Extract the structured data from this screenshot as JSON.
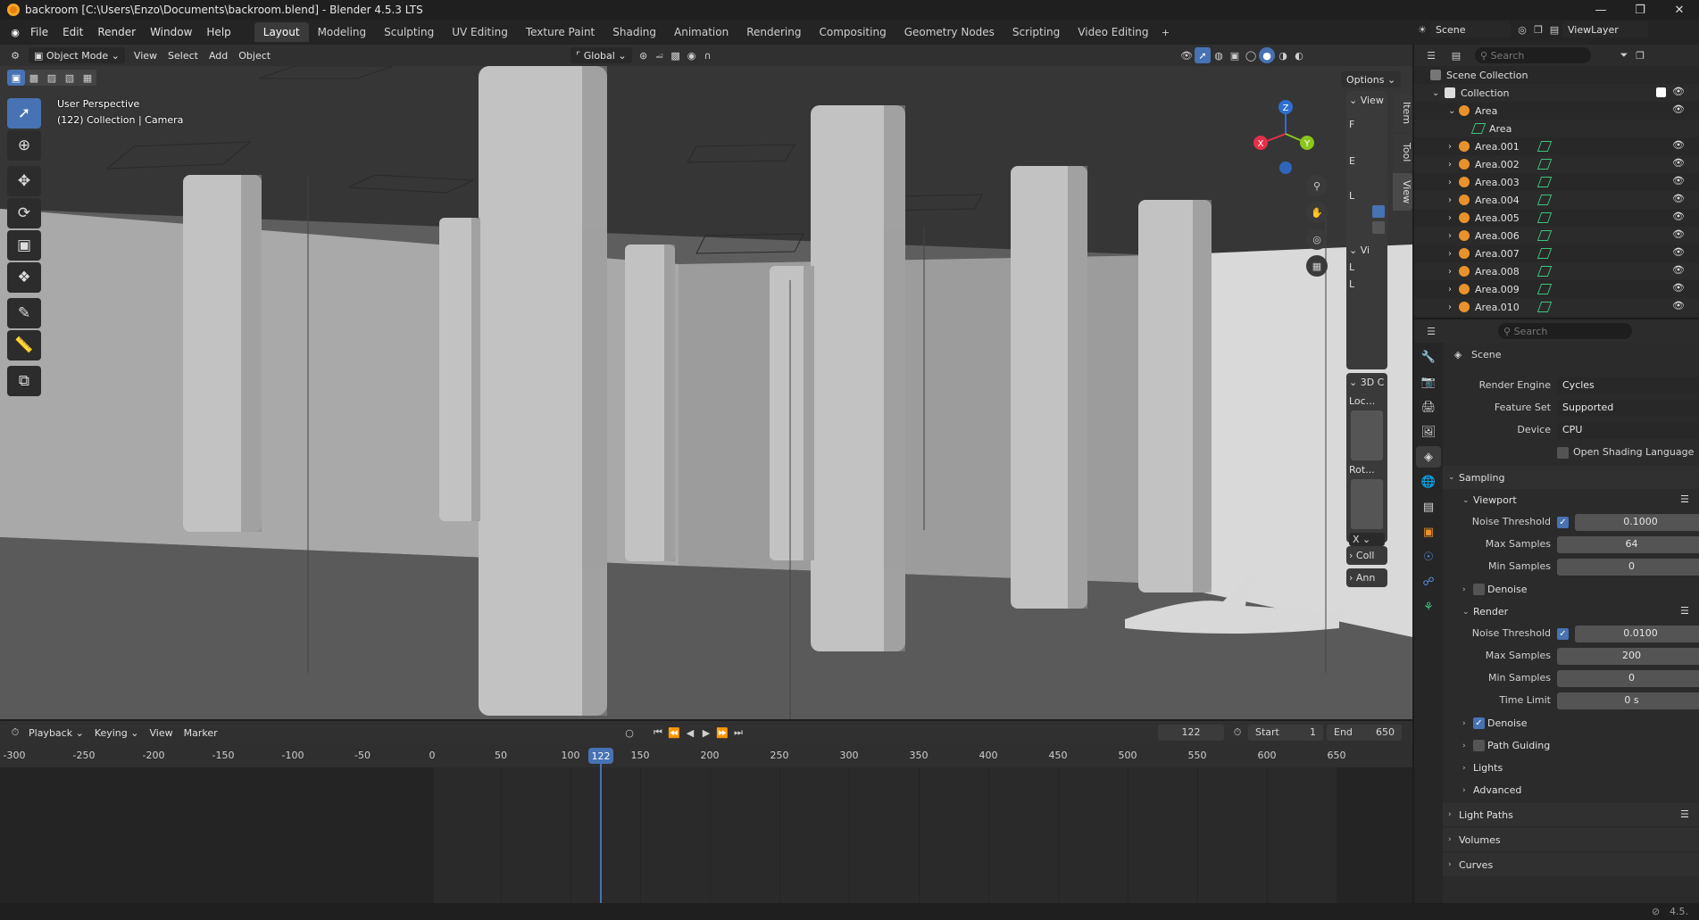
{
  "window": {
    "title": "backroom [C:\\Users\\Enzo\\Documents\\backroom.blend] - Blender 4.5.3 LTS"
  },
  "menu": [
    "File",
    "Edit",
    "Render",
    "Window",
    "Help"
  ],
  "workspaces": [
    "Layout",
    "Modeling",
    "Sculpting",
    "UV Editing",
    "Texture Paint",
    "Shading",
    "Animation",
    "Rendering",
    "Compositing",
    "Geometry Nodes",
    "Scripting",
    "Video Editing"
  ],
  "active_workspace": "Layout",
  "top_right": {
    "scene": "Scene",
    "view_layer": "ViewLayer"
  },
  "viewport_header": {
    "mode": "Object Mode",
    "menus": [
      "View",
      "Select",
      "Add",
      "Object"
    ],
    "transform_orientation": "Global",
    "options_label": "Options"
  },
  "viewport": {
    "view_name": "User Perspective",
    "collection_info": "(122) Collection | Camera"
  },
  "gizmo": {
    "z": "Z",
    "x": "X",
    "y": "Y"
  },
  "npanel": {
    "view_title": "View",
    "f_label": "F",
    "e_label": "E",
    "l_label": "L",
    "vi_title": "Vi",
    "l2": "L",
    "l3": "L",
    "cursor_title": "3D C",
    "loc_label": "Loc...",
    "rot_label": "Rot...",
    "x_dropdown": "X",
    "coll": "Coll",
    "ann": "Ann"
  },
  "side_tabs": [
    "Item",
    "Tool",
    "View"
  ],
  "timeline": {
    "menus": [
      "Playback",
      "Keying",
      "View",
      "Marker"
    ],
    "current_frame": "122",
    "start_label": "Start",
    "start": "1",
    "end_label": "End",
    "end": "650",
    "ticks": [
      "-300",
      "-250",
      "-200",
      "-150",
      "-100",
      "-50",
      "0",
      "50",
      "100",
      "150",
      "200",
      "250",
      "300",
      "350",
      "400",
      "450",
      "500",
      "550",
      "600",
      "650"
    ],
    "playhead": "122"
  },
  "outliner": {
    "search_placeholder": "Search",
    "scene_collection": "Scene Collection",
    "collection": "Collection",
    "area": "Area",
    "area_data": "Area",
    "items": [
      "Area.001",
      "Area.002",
      "Area.003",
      "Area.004",
      "Area.005",
      "Area.006",
      "Area.007",
      "Area.008",
      "Area.009",
      "Area.010"
    ]
  },
  "properties": {
    "search_placeholder": "Search",
    "context": "Scene",
    "render_engine_label": "Render Engine",
    "render_engine": "Cycles",
    "feature_set_label": "Feature Set",
    "feature_set": "Supported",
    "device_label": "Device",
    "device": "CPU",
    "osl": "Open Shading Language",
    "sampling": "Sampling",
    "viewport": "Viewport",
    "noise_threshold_label": "Noise Threshold",
    "vp_noise_threshold": "0.1000",
    "max_samples_label": "Max Samples",
    "vp_max_samples": "64",
    "min_samples_label": "Min Samples",
    "vp_min_samples": "0",
    "denoise": "Denoise",
    "render": "Render",
    "r_noise_threshold": "0.0100",
    "r_max_samples": "200",
    "r_min_samples": "0",
    "time_limit_label": "Time Limit",
    "time_limit": "0 s",
    "r_denoise": "Denoise",
    "path_guiding": "Path Guiding",
    "lights": "Lights",
    "advanced": "Advanced",
    "light_paths": "Light Paths",
    "volumes": "Volumes",
    "curves": "Curves"
  },
  "status": {
    "version": "4.5."
  }
}
